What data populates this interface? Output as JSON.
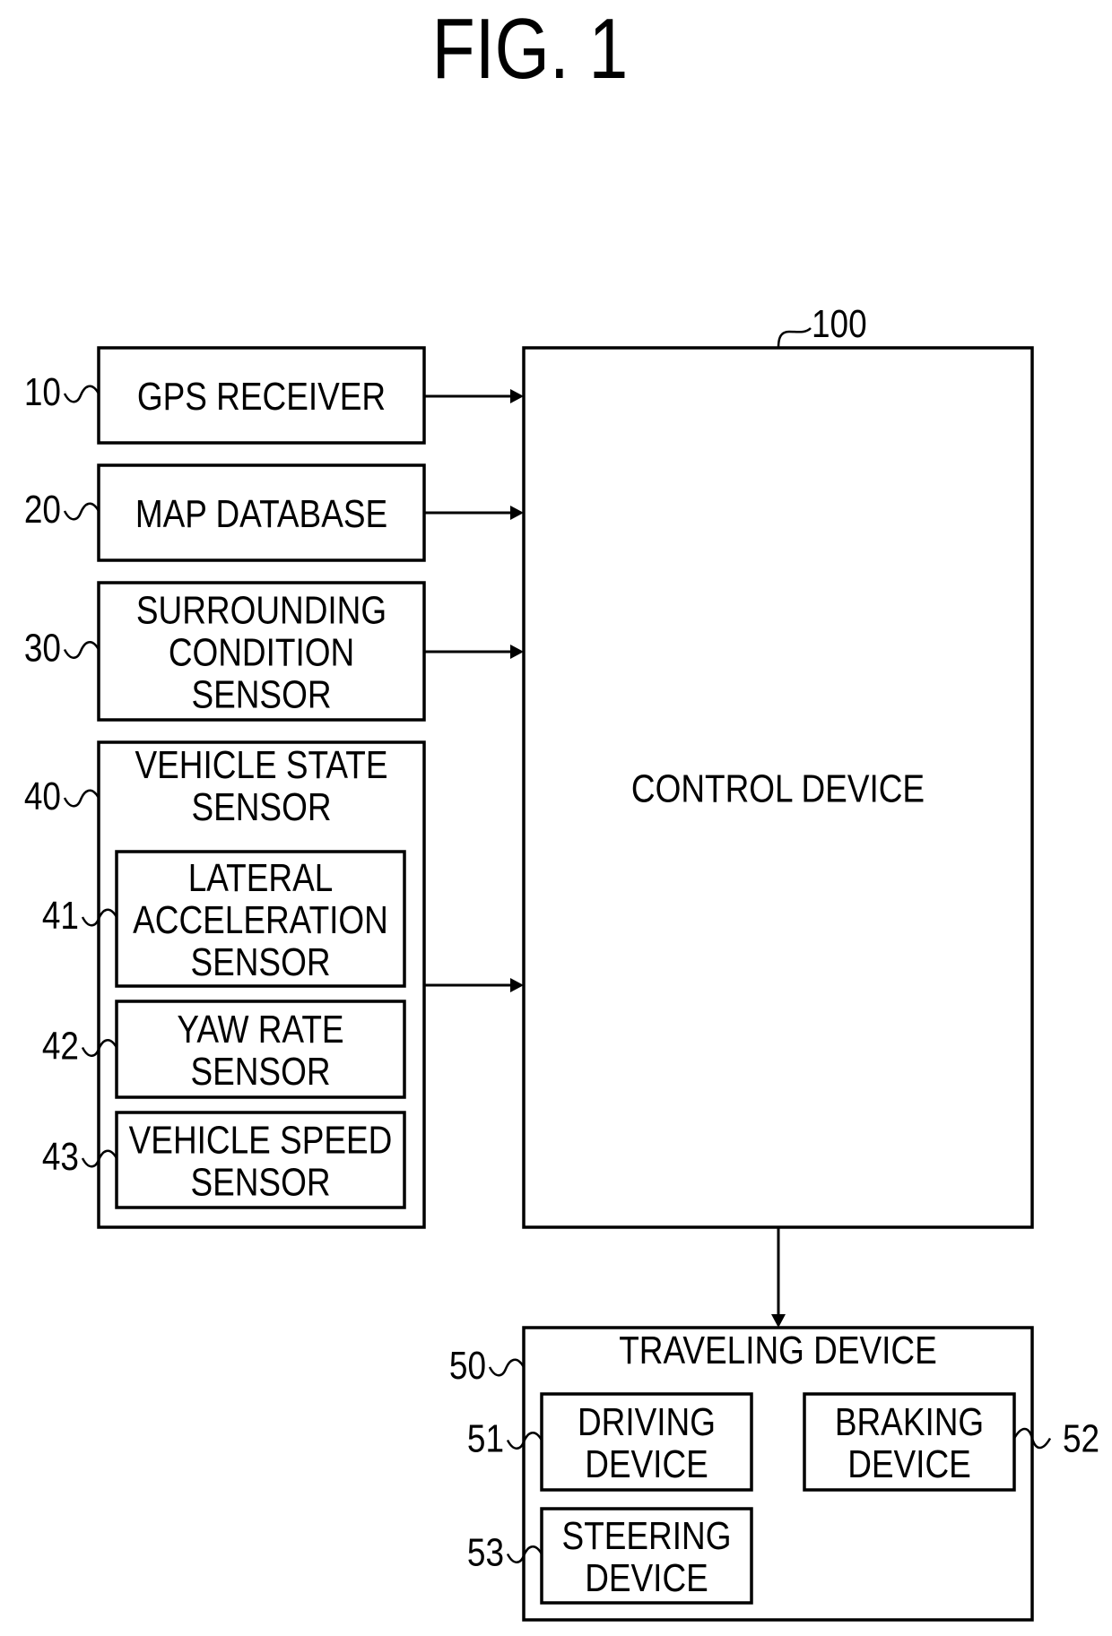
{
  "figure": {
    "title": "FIG. 1"
  },
  "blocks": {
    "gps": {
      "ref": "10",
      "lines": [
        "GPS RECEIVER"
      ]
    },
    "map": {
      "ref": "20",
      "lines": [
        "MAP DATABASE"
      ]
    },
    "surrounding": {
      "ref": "30",
      "lines": [
        "SURROUNDING",
        "CONDITION",
        "SENSOR"
      ]
    },
    "vehicle_state": {
      "ref": "40",
      "lines": [
        "VEHICLE STATE",
        "SENSOR"
      ]
    },
    "lateral": {
      "ref": "41",
      "lines": [
        "LATERAL",
        "ACCELERATION",
        "SENSOR"
      ]
    },
    "yaw": {
      "ref": "42",
      "lines": [
        "YAW RATE",
        "SENSOR"
      ]
    },
    "speed": {
      "ref": "43",
      "lines": [
        "VEHICLE SPEED",
        "SENSOR"
      ]
    },
    "control": {
      "ref": "100",
      "lines": [
        "CONTROL DEVICE"
      ]
    },
    "traveling": {
      "ref": "50",
      "lines": [
        "TRAVELING DEVICE"
      ]
    },
    "driving": {
      "ref": "51",
      "lines": [
        "DRIVING",
        "DEVICE"
      ]
    },
    "braking": {
      "ref": "52",
      "lines": [
        "BRAKING",
        "DEVICE"
      ]
    },
    "steering": {
      "ref": "53",
      "lines": [
        "STEERING",
        "DEVICE"
      ]
    }
  },
  "connections": [
    {
      "from": "gps",
      "to": "control"
    },
    {
      "from": "map",
      "to": "control"
    },
    {
      "from": "surrounding",
      "to": "control"
    },
    {
      "from": "vehicle_state",
      "to": "control"
    },
    {
      "from": "control",
      "to": "traveling"
    }
  ]
}
